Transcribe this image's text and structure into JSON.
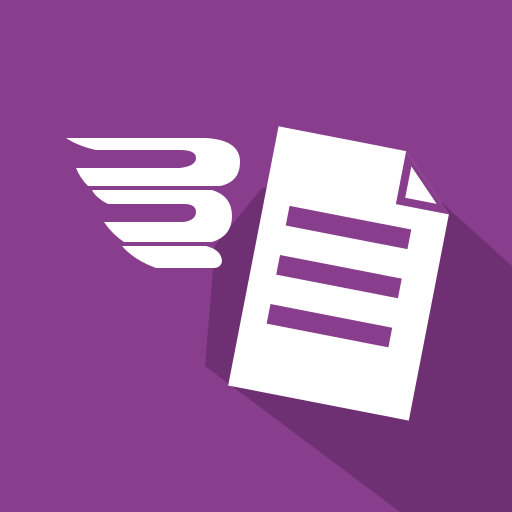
{
  "icon": {
    "name": "flying-document-app-icon",
    "glyph": "winged-document-icon",
    "colors": {
      "background": "#883e8c",
      "long_shadow": "#6f3073",
      "foreground": "#ffffff",
      "document_lines": "#883e8c"
    }
  }
}
